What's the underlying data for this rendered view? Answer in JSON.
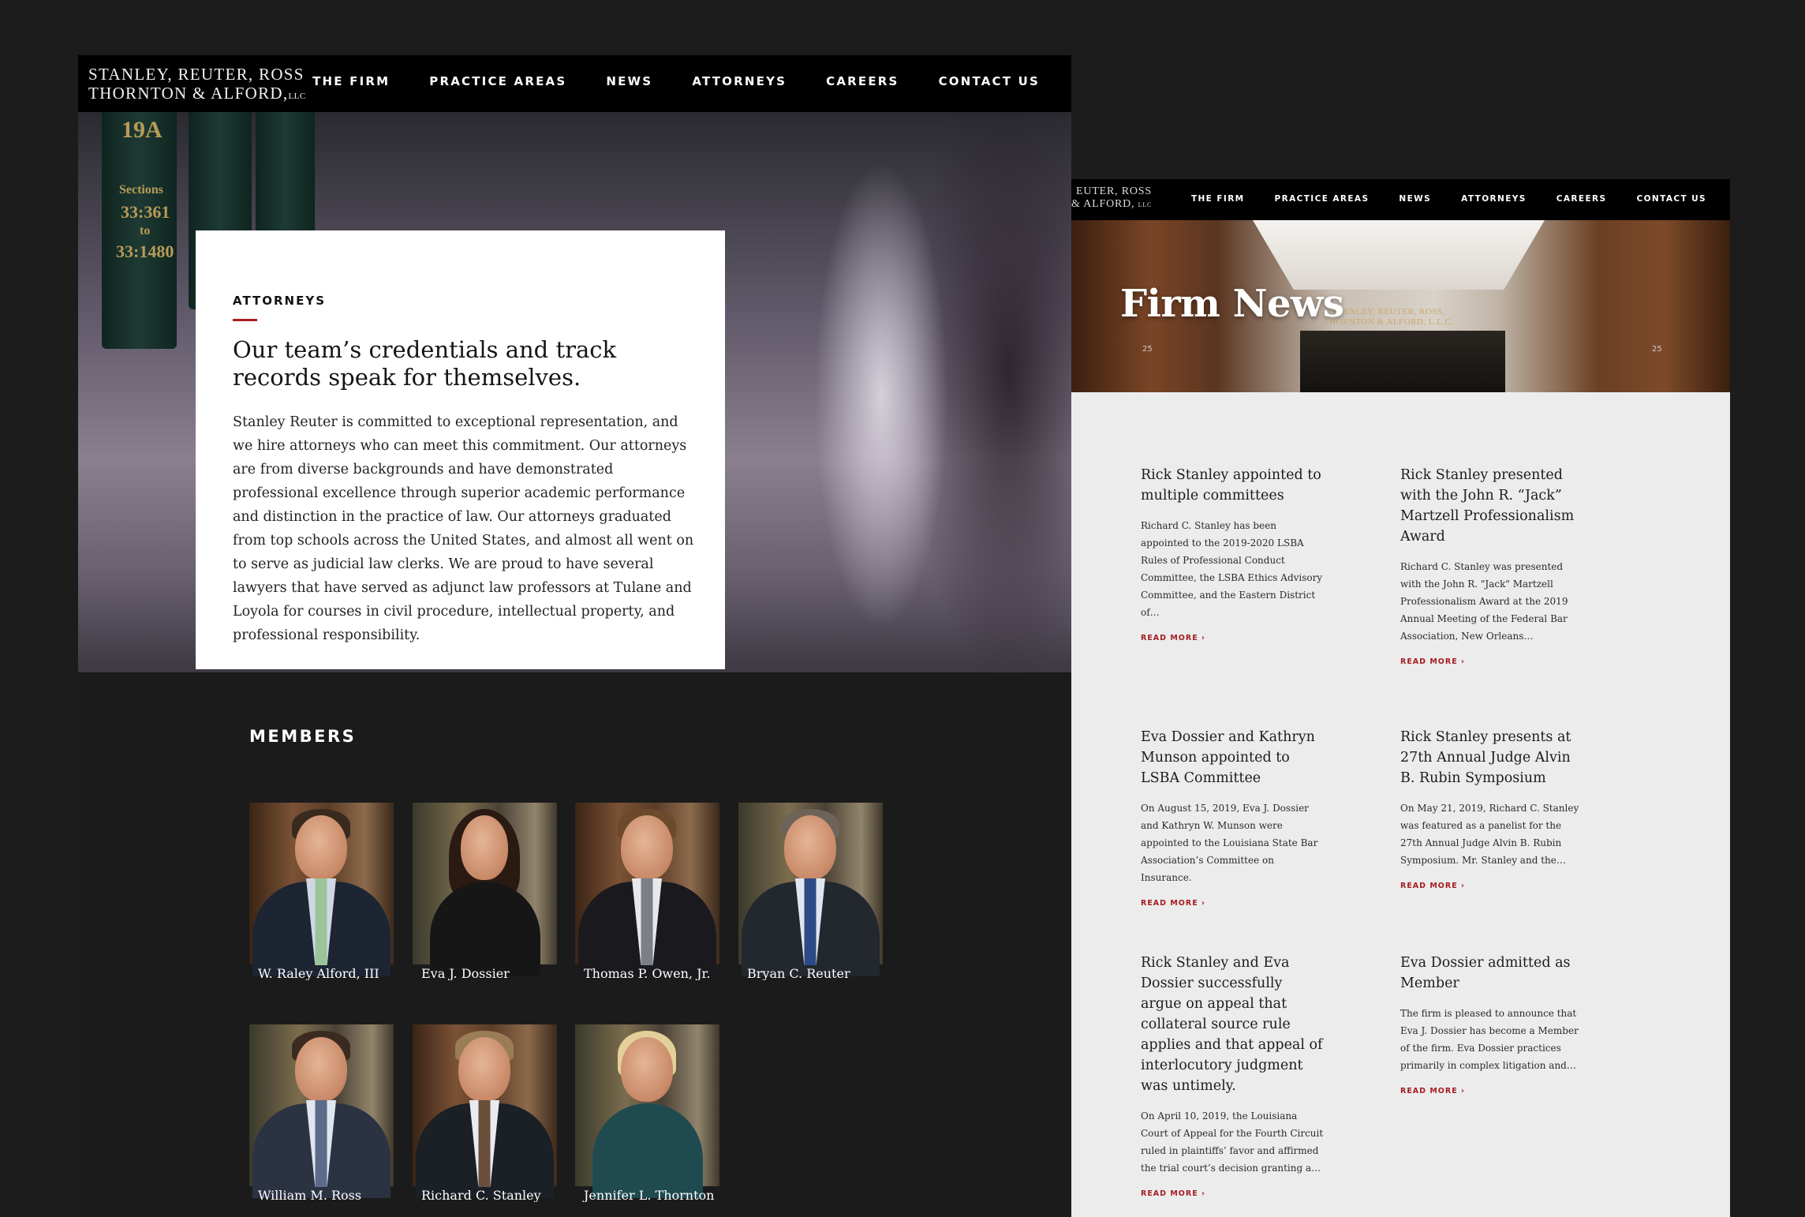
{
  "attorneys_page": {
    "logo": {
      "line1": "STANLEY, REUTER, ROSS",
      "line2": "THORNTON & ALFORD,",
      "llc": "LLC"
    },
    "nav": [
      "THE FIRM",
      "PRACTICE AREAS",
      "NEWS",
      "ATTORNEYS",
      "CAREERS",
      "CONTACT US"
    ],
    "hero": {
      "spine_labels": [
        "19A",
        "Sections",
        "33:361",
        "to",
        "33:1480"
      ],
      "eyebrow": "ATTORNEYS",
      "heading": "Our team’s credentials and track records speak for themselves.",
      "body": "Stanley Reuter is committed to exceptional representation, and we hire attorneys who can meet this commitment. Our attorneys are from diverse backgrounds and have demonstrated professional excellence through superior academic performance and distinction in the practice of law.  Our attorneys graduated from top schools across the United States, and almost all went on to serve as judicial law clerks.  We are proud to have several lawyers that have served as adjunct law professors at Tulane and Loyola for courses in civil procedure, intellectual property, and professional responsibility."
    },
    "members_title": "MEMBERS",
    "members": [
      {
        "name": "W. Raley Alford, III"
      },
      {
        "name": "Eva J. Dossier"
      },
      {
        "name": "Thomas P. Owen, Jr."
      },
      {
        "name": "Bryan C. Reuter"
      },
      {
        "name": "William M. Ross"
      },
      {
        "name": "Richard C. Stanley"
      },
      {
        "name": "Jennifer L. Thornton"
      }
    ]
  },
  "news_page": {
    "logo": {
      "line1": "EUTER, ROSS",
      "line2": "& ALFORD,",
      "llc": "LLC"
    },
    "nav": [
      "THE FIRM",
      "PRACTICE AREAS",
      "NEWS",
      "ATTORNEYS",
      "CAREERS",
      "CONTACT US"
    ],
    "hero": {
      "title": "Firm News",
      "sign_line1": "STANLEY, REUTER, ROSS,",
      "sign_line2": "THORNTON & ALFORD, L.L.C.",
      "floor_numbers": [
        "25",
        "25"
      ]
    },
    "read_more": "READ MORE",
    "articles": [
      {
        "title": "Rick Stanley appointed to multiple committees",
        "excerpt": "Richard C. Stanley has been appointed to the 2019-2020 LSBA Rules of Professional Conduct Committee, the LSBA Ethics Advisory Committee, and the Eastern District of…"
      },
      {
        "title": "Rick Stanley presented with the John R. “Jack” Martzell Professionalism Award",
        "excerpt": "Richard C. Stanley was presented with the John R. \"Jack\" Martzell Professionalism Award at the 2019 Annual Meeting of the Federal Bar Association, New Orleans…"
      },
      {
        "title": "Eva Dossier and Kathryn Munson appointed to LSBA Committee",
        "excerpt": "On August 15, 2019, Eva J. Dossier and Kathryn W. Munson were appointed to the Louisiana State Bar Association’s Committee on Insurance."
      },
      {
        "title": "Rick Stanley presents at 27th Annual Judge Alvin B. Rubin Symposium",
        "excerpt": "On May 21, 2019, Richard C. Stanley was featured as a panelist for the 27th Annual Judge Alvin B. Rubin Symposium. Mr. Stanley and the…"
      },
      {
        "title": "Rick Stanley and Eva Dossier successfully argue on appeal that collateral source rule applies and that appeal of interlocutory judgment was untimely.",
        "excerpt": "On April 10, 2019, the Louisiana Court of Appeal for the Fourth Circuit ruled in plaintiffs’ favor and affirmed the trial court’s decision granting a…"
      },
      {
        "title": "Eva Dossier admitted as Member",
        "excerpt": "The firm is pleased to announce that Eva J. Dossier has become a Member of the firm. Eva Dossier practices primarily in complex litigation and…"
      }
    ]
  },
  "colors": {
    "accent": "#a61d24",
    "nav_bg": "#000000",
    "page_bg": "#1c1c1c",
    "news_bg": "#ececec"
  }
}
